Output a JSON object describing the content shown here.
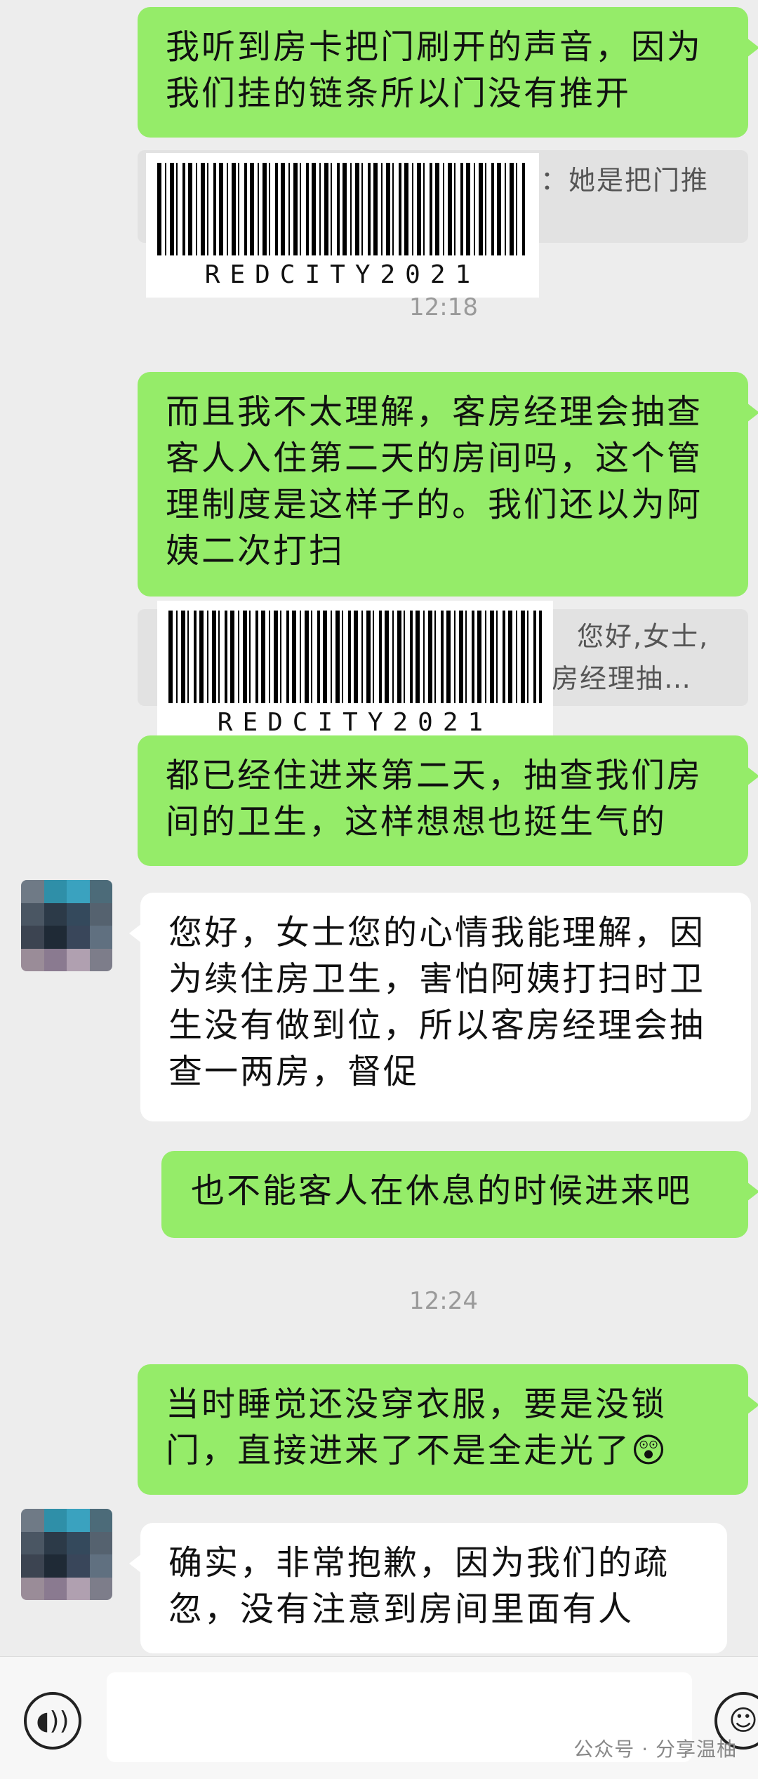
{
  "messages": {
    "m1": "我听到房卡把门刷开的声音，因为我们挂的链条所以门没有推开",
    "q1": "：她是把门推",
    "t1": "12:18",
    "m2": "而且我不太理解，客房经理会抽查客人入住第二天的房间吗，这个管理制度是这样子的。我们还以为阿姨二次打扫",
    "q2_line1": "您好,女士,",
    "q2_line2": "房经理抽…",
    "m3": "都已经住进来第二天，抽查我们房间的卫生，这样想想也挺生气的",
    "r1": "您好，女士您的心情我能理解，因为续住房卫生，害怕阿姨打扫时卫生没有做到位，所以客房经理会抽查一两房，督促",
    "m4": "也不能客人在休息的时候进来吧",
    "t2": "12:24",
    "m5": "当时睡觉还没穿衣服，要是没锁门，直接进来了不是全走光了",
    "m5_emoji": "😲",
    "r2": "确实，非常抱歉，因为我们的疏忽，没有注意到房间里面有人"
  },
  "barcode": {
    "text": "REDCITY2021"
  },
  "input_bar": {
    "voice_icon": "voice-icon",
    "emoji_icon": "emoji-icon",
    "watermark": "公众号 · 分享温柚"
  },
  "colors": {
    "green_bubble": "#95ec69",
    "white_bubble": "#ffffff",
    "background": "#ededed"
  }
}
